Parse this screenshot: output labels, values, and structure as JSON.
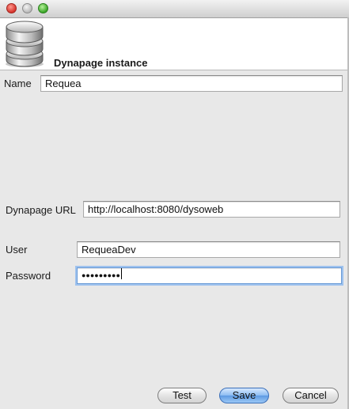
{
  "window": {
    "title": ""
  },
  "header": {
    "icon": "database-icon",
    "title": "Dynapage instance"
  },
  "form": {
    "name_label": "Name",
    "name_value": "Requea",
    "url_label": "Dynapage URL",
    "url_value": "http://localhost:8080/dysoweb",
    "user_label": "User",
    "user_value": "RequeaDev",
    "password_label": "Password",
    "password_mask": "●●●●●●●●●"
  },
  "buttons": {
    "test": "Test",
    "save": "Save",
    "cancel": "Cancel"
  },
  "colors": {
    "close": "#d6322b",
    "minimize": "#b9b9b9",
    "zoom": "#3aa627",
    "default_button": "#5d9ae3",
    "focus_ring": "#9ec2ee"
  }
}
